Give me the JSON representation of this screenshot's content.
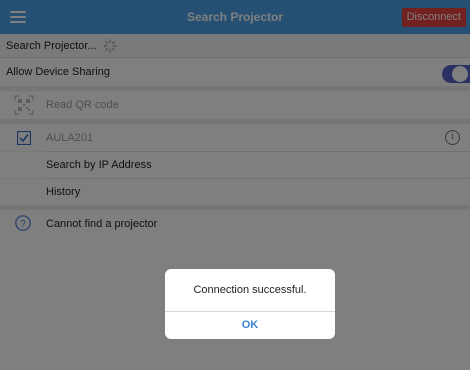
{
  "navbar": {
    "title": "Search Projector",
    "disconnect_label": "Disconnect",
    "colors": {
      "bar": "#4aa0e6",
      "disconnect": "#e64040"
    }
  },
  "search_row": {
    "label": "Search Projector...",
    "icon": "spinner-icon"
  },
  "sharing": {
    "label": "Allow Device Sharing",
    "toggle_on": true,
    "toggle_color": "#5063c4"
  },
  "qr": {
    "label": "Read QR code",
    "icon": "qr-code-icon"
  },
  "projector": {
    "name": "AULA201",
    "checked": true,
    "info_icon": "info-icon"
  },
  "menu": {
    "ip_search": "Search by IP Address",
    "history": "History"
  },
  "help": {
    "label": "Cannot find a projector",
    "icon": "question-circle-icon"
  },
  "dialog": {
    "message": "Connection successful.",
    "ok_label": "OK",
    "ok_color": "#3b82d1"
  }
}
